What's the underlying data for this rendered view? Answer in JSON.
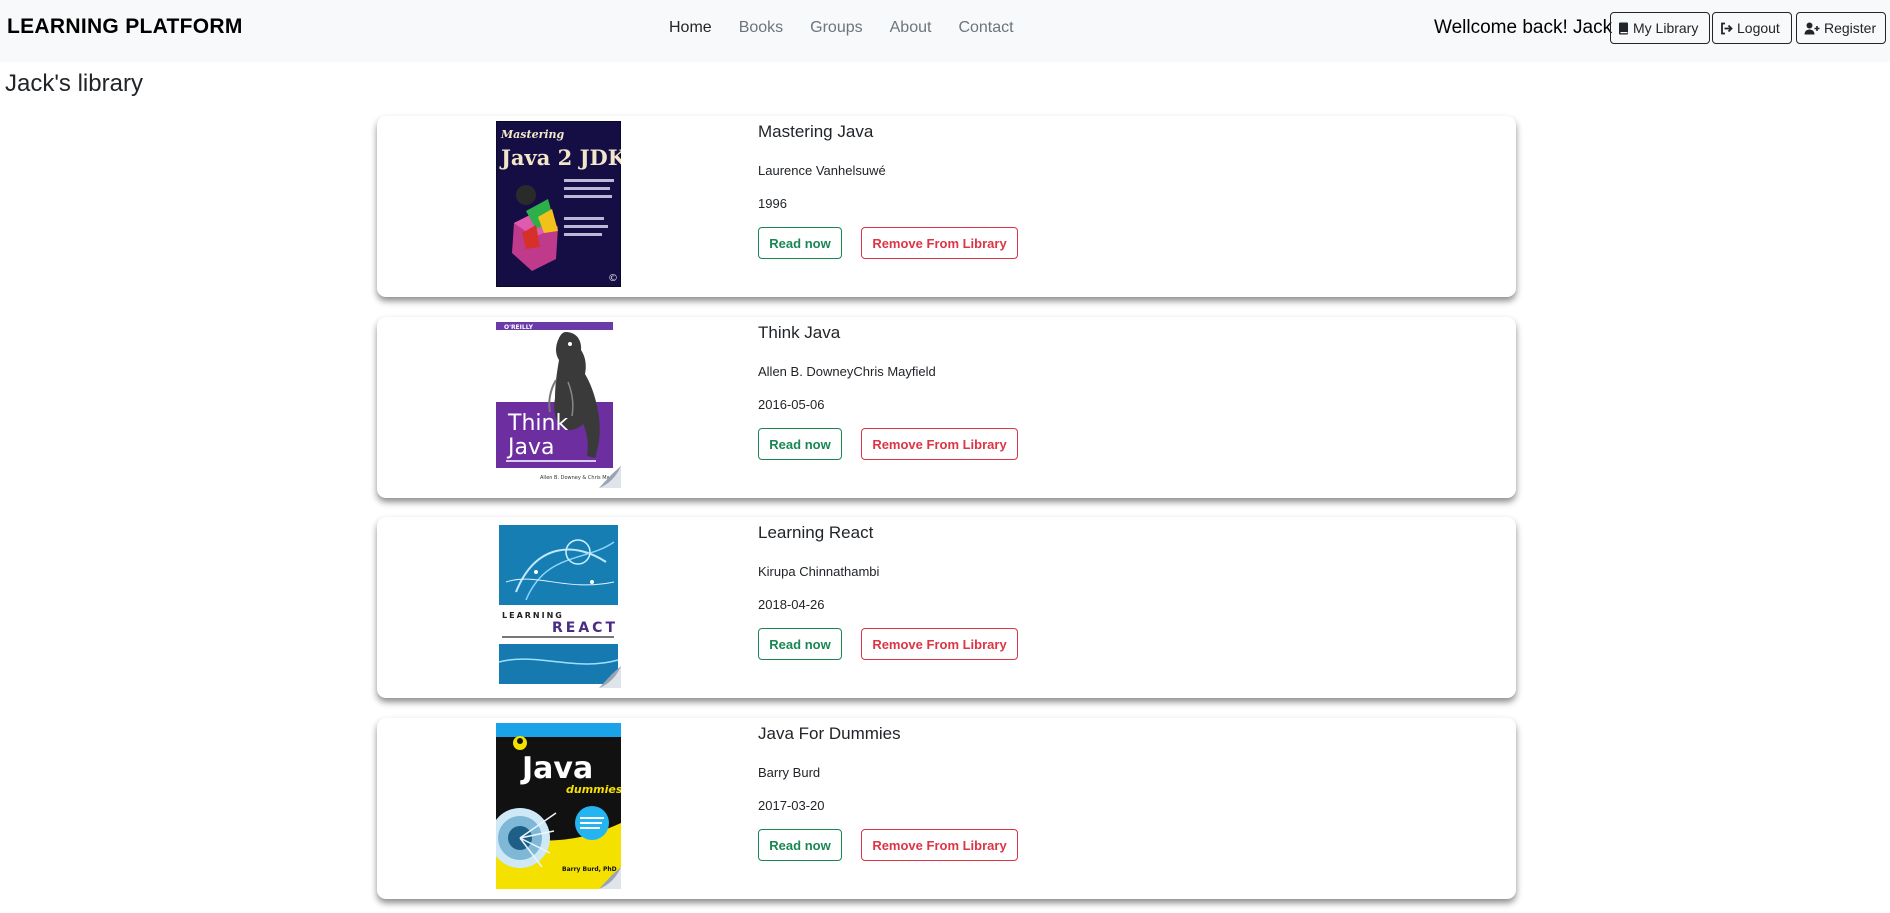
{
  "navbar": {
    "brand": "LEARNING PLATFORM",
    "links": [
      "Home",
      "Books",
      "Groups",
      "About",
      "Contact"
    ],
    "welcome": "Wellcome back! Jack",
    "buttons": {
      "my_library": "My Library",
      "logout": "Logout",
      "register": "Register"
    }
  },
  "page": {
    "title": "Jack's library"
  },
  "buttons": {
    "read": "Read now",
    "remove": "Remove From Library"
  },
  "books": [
    {
      "title": "Mastering Java",
      "author": "Laurence Vanhelsuwé",
      "date": "1996",
      "cover": {
        "line1": "Mastering",
        "line2": "Java 2 JDK"
      }
    },
    {
      "title": "Think Java",
      "author": "Allen B. DowneyChris Mayfield",
      "date": "2016-05-06",
      "cover": {
        "publisher": "O'REILLY",
        "line1": "Think",
        "line2": "Java",
        "authors": "Allen B. Downey & Chris Ma"
      }
    },
    {
      "title": "Learning React",
      "author": "Kirupa Chinnathambi",
      "date": "2018-04-26",
      "cover": {
        "line1": "LEARNING",
        "line2": "REACT"
      }
    },
    {
      "title": "Java For Dummies",
      "author": "Barry Burd",
      "date": "2017-03-20",
      "cover": {
        "line1": "Java",
        "line2": "dummies",
        "authors": "Barry Burd, PhD"
      }
    }
  ],
  "colors": {
    "navbar_bg": "#f8f9fa",
    "success": "#198754",
    "danger": "#dc3545",
    "muted_link": "#6c757d"
  }
}
